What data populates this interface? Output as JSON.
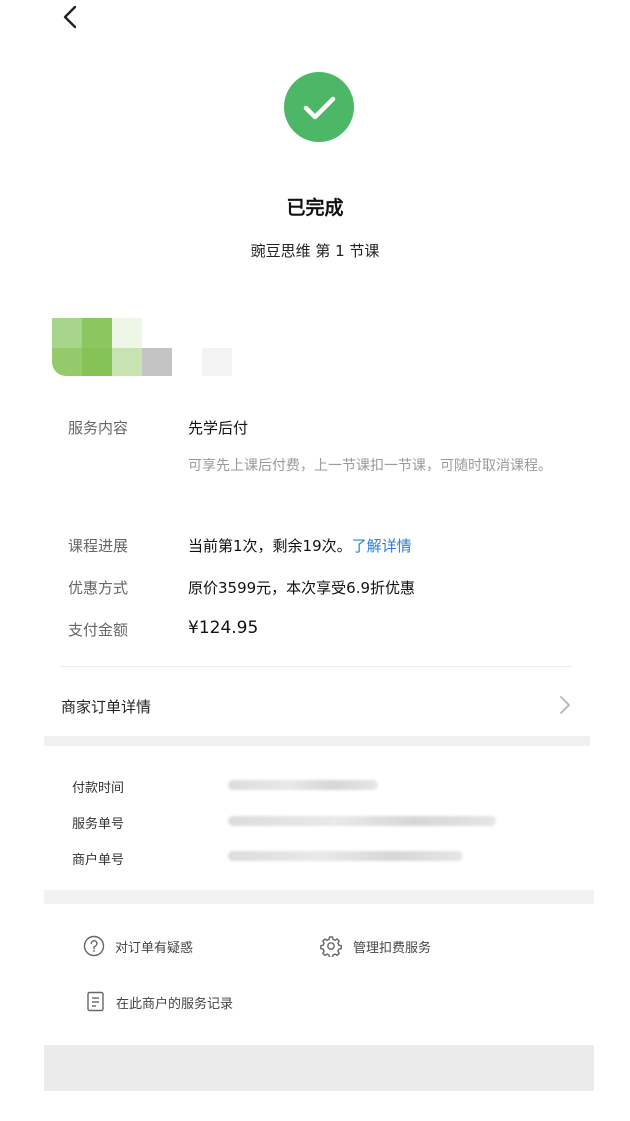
{
  "status": {
    "title": "已完成",
    "subtitle": "豌豆思维 第 1 节课",
    "icon": "check-circle-icon",
    "color": "#4cb867"
  },
  "info": {
    "service_label": "服务内容",
    "service_value": "先学后付",
    "service_desc": "可享先上课后付费，上一节课扣一节课，可随时取消课程。",
    "progress_label": "课程进展",
    "progress_value": "当前第1次，剩余19次。",
    "progress_link": "了解详情",
    "discount_label": "优惠方式",
    "discount_value": "原价3599元，本次享受6.9折优惠",
    "amount_label": "支付金额",
    "amount_value": "¥124.95"
  },
  "merchant_order": {
    "label": "商家订单详情"
  },
  "details": {
    "pay_time_label": "付款时间",
    "service_no_label": "服务单号",
    "merchant_no_label": "商户单号"
  },
  "actions": {
    "question_label": "对订单有疑惑",
    "manage_label": "管理扣费服务",
    "records_label": "在此商户的服务记录"
  },
  "colors": {
    "accent_green": "#4cb867",
    "link_blue": "#2a7dd6"
  }
}
